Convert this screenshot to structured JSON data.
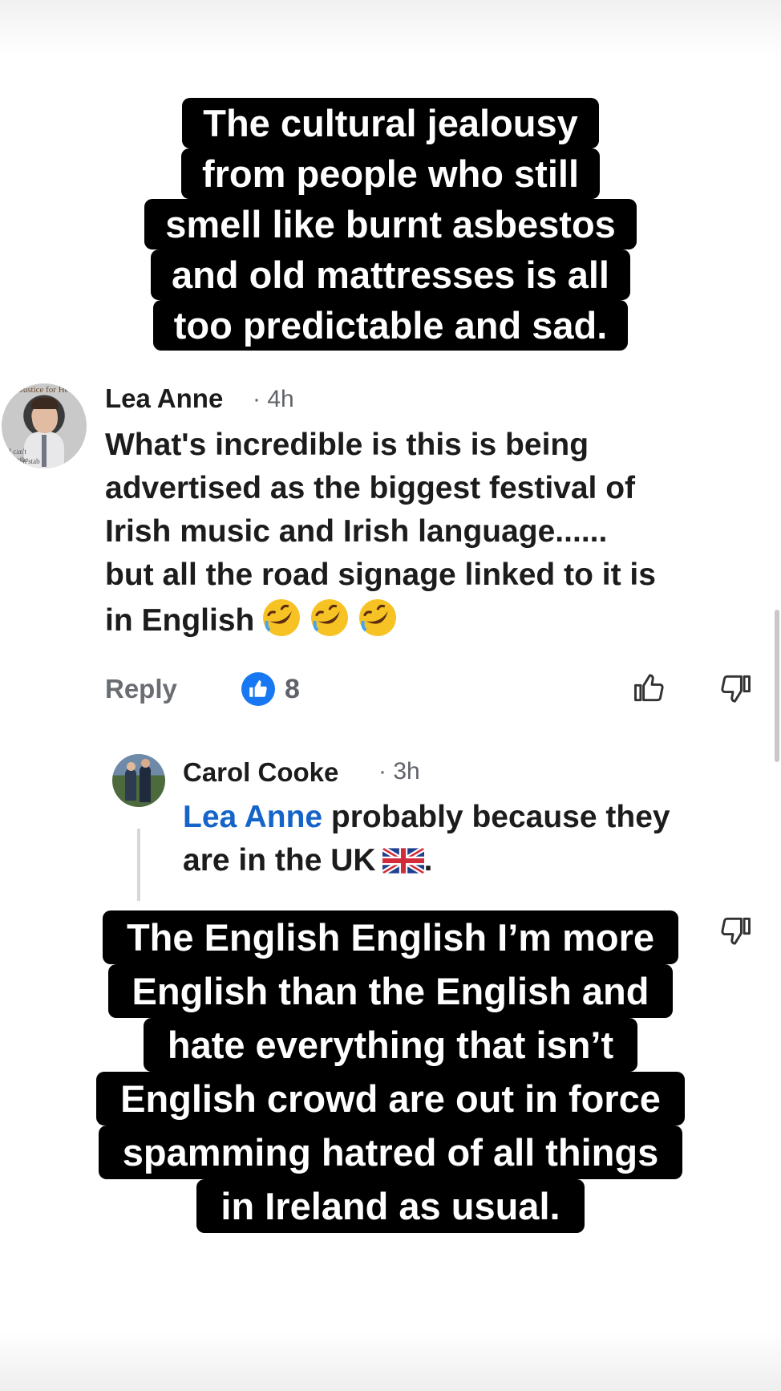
{
  "caption_top": {
    "lines": [
      "The cultural jealousy",
      "from people who still",
      "smell like burnt asbestos",
      "and old mattresses is all",
      "too predictable and sad."
    ]
  },
  "comments": [
    {
      "author": "Lea Anne",
      "time": "· 4h",
      "avatar_text": "Justice for He",
      "avatar_text_2": "I can't breathe",
      "avatar_text_3": "Been stab",
      "body_lines": [
        "What's incredible is this is being",
        "advertised as the biggest festival of",
        "Irish music and Irish language......",
        "but all the road signage linked to it is",
        "in English"
      ],
      "emoji": [
        "rolling-on-floor-laughing",
        "rolling-on-floor-laughing",
        "rolling-on-floor-laughing"
      ],
      "reply_label": "Reply",
      "like_count": "8"
    },
    {
      "author": "Carol Cooke",
      "time": "· 3h",
      "mention": "Lea Anne",
      "body_line_1_rest": " probably because they",
      "body_line_2": "are in the UK",
      "body_line_2_end": ".",
      "flag": "uk-flag"
    }
  ],
  "caption_bottom": {
    "lines": [
      "The English English I’m more",
      "English than the English and",
      "hate everything that isn’t",
      "English crowd are out in force",
      "spamming hatred of all things",
      "in Ireland as usual."
    ]
  },
  "colors": {
    "caption_bg": "#000000",
    "caption_text": "#ffffff",
    "like_blue": "#1877f2",
    "mention_blue": "#1664c9",
    "meta_gray": "#5f6369"
  }
}
